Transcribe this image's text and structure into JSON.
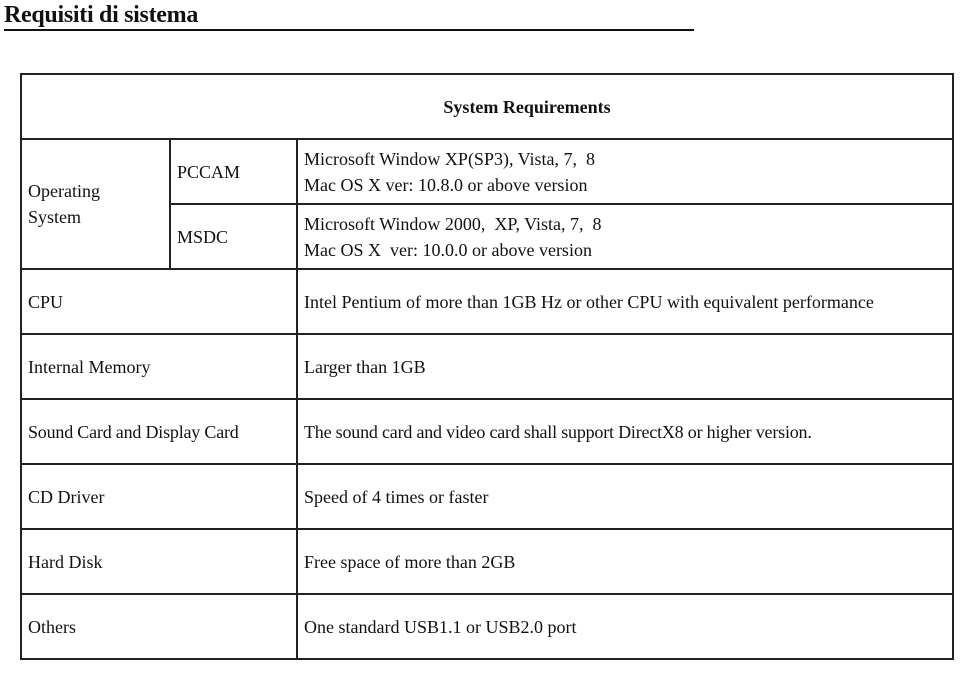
{
  "page": {
    "title": "Requisiti di sistema"
  },
  "table": {
    "header": "System Requirements",
    "os": {
      "label": "Operating System",
      "label_line1": "Operating",
      "label_line2": "System",
      "pccam": {
        "label": "PCCAM",
        "line1": "Microsoft Window XP(SP3), Vista, 7,  8",
        "line2": "Mac OS X ver: 10.8.0 or above version"
      },
      "msdc": {
        "label": "MSDC",
        "line1": "Microsoft Window 2000,  XP, Vista, 7,  8",
        "line2": "Mac OS X  ver: 10.0.0 or above version"
      }
    },
    "rows": [
      {
        "label": "CPU",
        "value": "Intel Pentium of more than 1GB Hz or other CPU with equivalent performance"
      },
      {
        "label": "Internal Memory",
        "value": "Larger than 1GB"
      },
      {
        "label": "Sound Card and Display Card",
        "value": "The sound card and video card shall support DirectX8 or higher version."
      },
      {
        "label": "CD Driver",
        "value": "Speed of 4 times or faster"
      },
      {
        "label": "Hard Disk",
        "value": "Free space of more than 2GB"
      },
      {
        "label": "Others",
        "value": "One standard USB1.1 or USB2.0 port"
      }
    ]
  }
}
